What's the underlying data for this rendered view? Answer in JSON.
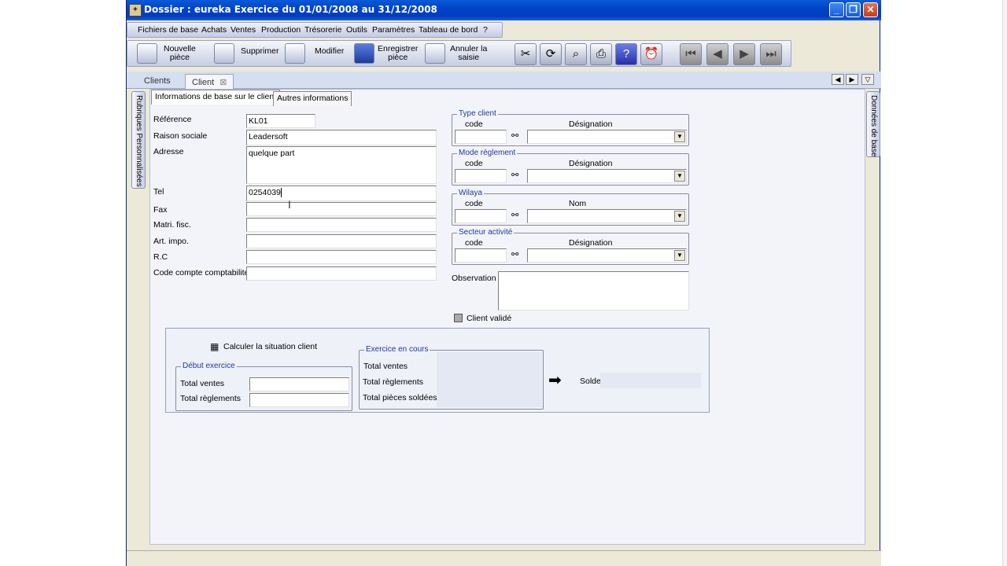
{
  "window": {
    "title": "Dossier : eureka Exercice du 01/01/2008 au 31/12/2008",
    "controls": [
      "_",
      "❐",
      "✕"
    ]
  },
  "menu": {
    "items": [
      "Fichiers de base",
      "Achats",
      "Ventes",
      "Production",
      "Trésorerie",
      "Outils",
      "Paramètres",
      "Tableau de bord",
      "?"
    ]
  },
  "toolbar": {
    "nouvelle_piece": "Nouvelle\npièce",
    "supprimer": "Supprimer",
    "modifier": "Modifier",
    "enregistrer_piece": "Enregistrer\npièce",
    "annuler_saisie": "Annuler la\nsaisie",
    "tools": [
      "tools-icon",
      "refresh-icon",
      "search-icon",
      "print-icon",
      "help-icon",
      "alarm-icon"
    ],
    "nav": [
      "first-icon",
      "prev-icon",
      "next-icon",
      "last-icon"
    ]
  },
  "doc_tabs": [
    "Clients",
    "Client"
  ],
  "vertical_tabs": {
    "left": "Rubriques Personnalisées",
    "right": "Données de base"
  },
  "sub_tabs": [
    "Informations de base sur le client",
    "Autres informations"
  ],
  "form": {
    "reference_label": "Référence",
    "reference_value": "KL01",
    "raison_sociale_label": "Raison sociale",
    "raison_sociale_value": "Leadersoft",
    "adresse_label": "Adresse",
    "adresse_value": "quelque part",
    "tel_label": "Tel",
    "tel_value": "0254039",
    "fax_label": "Fax",
    "fax_value": "",
    "matri_fisc_label": "Matri. fisc.",
    "matri_fisc_value": "",
    "art_impo_label": "Art. impo.",
    "art_impo_value": "",
    "rc_label": "R.C",
    "rc_value": "",
    "code_compte_label": "Code compte comptabilité",
    "code_compte_value": ""
  },
  "groups": [
    {
      "legend": "Type client",
      "col1": "code",
      "col2": "Désignation"
    },
    {
      "legend": "Mode règlement",
      "col1": "code",
      "col2": "Désignation"
    },
    {
      "legend": "Wilaya",
      "col1": "code",
      "col2": "Nom"
    },
    {
      "legend": "Secteur activité",
      "col1": "code",
      "col2": "Désignation"
    }
  ],
  "observation_label": "Observation",
  "client_valide_label": "Client validé",
  "situation": {
    "calculer_label": "Calculer la situation client",
    "debut_exercice_legend": "Début exercice",
    "total_ventes": "Total ventes",
    "total_reglements": "Total règlements",
    "exercice_en_cours_legend": "Exercice en cours",
    "total_pieces_soldees": "Total pièces soldées",
    "solde_label": "Solde"
  },
  "colors": {
    "title_bar": "#0044c8",
    "legend_text": "#1c3c94",
    "panel_bg": "#f2f4fa"
  }
}
